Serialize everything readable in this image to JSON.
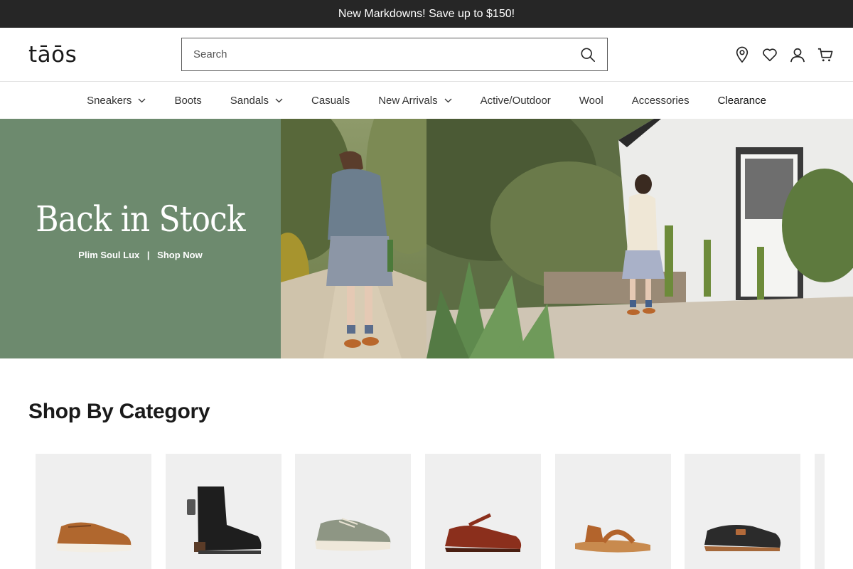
{
  "promo": {
    "text": "New Markdowns! Save up to $150!"
  },
  "header": {
    "logo": "tāōs",
    "search": {
      "placeholder": "Search",
      "value": ""
    },
    "icons": [
      "location-icon",
      "heart-icon",
      "account-icon",
      "cart-icon"
    ]
  },
  "nav": {
    "items": [
      {
        "label": "Sneakers",
        "dropdown": true
      },
      {
        "label": "Boots",
        "dropdown": false
      },
      {
        "label": "Sandals",
        "dropdown": true
      },
      {
        "label": "Casuals",
        "dropdown": false
      },
      {
        "label": "New Arrivals",
        "dropdown": true
      },
      {
        "label": "Active/Outdoor",
        "dropdown": false
      },
      {
        "label": "Wool",
        "dropdown": false
      },
      {
        "label": "Accessories",
        "dropdown": false
      },
      {
        "label": "Clearance",
        "dropdown": false
      }
    ]
  },
  "hero": {
    "title": "Back in Stock",
    "product": "Plim Soul Lux",
    "separator": "|",
    "cta": "Shop Now",
    "panel_color": "#6d8a6e"
  },
  "category_section": {
    "title": "Shop By Category",
    "cards": [
      {
        "icon": "brown-sneaker-icon"
      },
      {
        "icon": "black-boot-icon"
      },
      {
        "icon": "olive-sneaker-icon"
      },
      {
        "icon": "red-mary-jane-icon"
      },
      {
        "icon": "tan-sandal-icon"
      },
      {
        "icon": "wool-clog-icon"
      }
    ]
  },
  "colors": {
    "promo_bg": "#262626",
    "hero_green": "#6d8a6e",
    "card_bg": "#efefef"
  }
}
